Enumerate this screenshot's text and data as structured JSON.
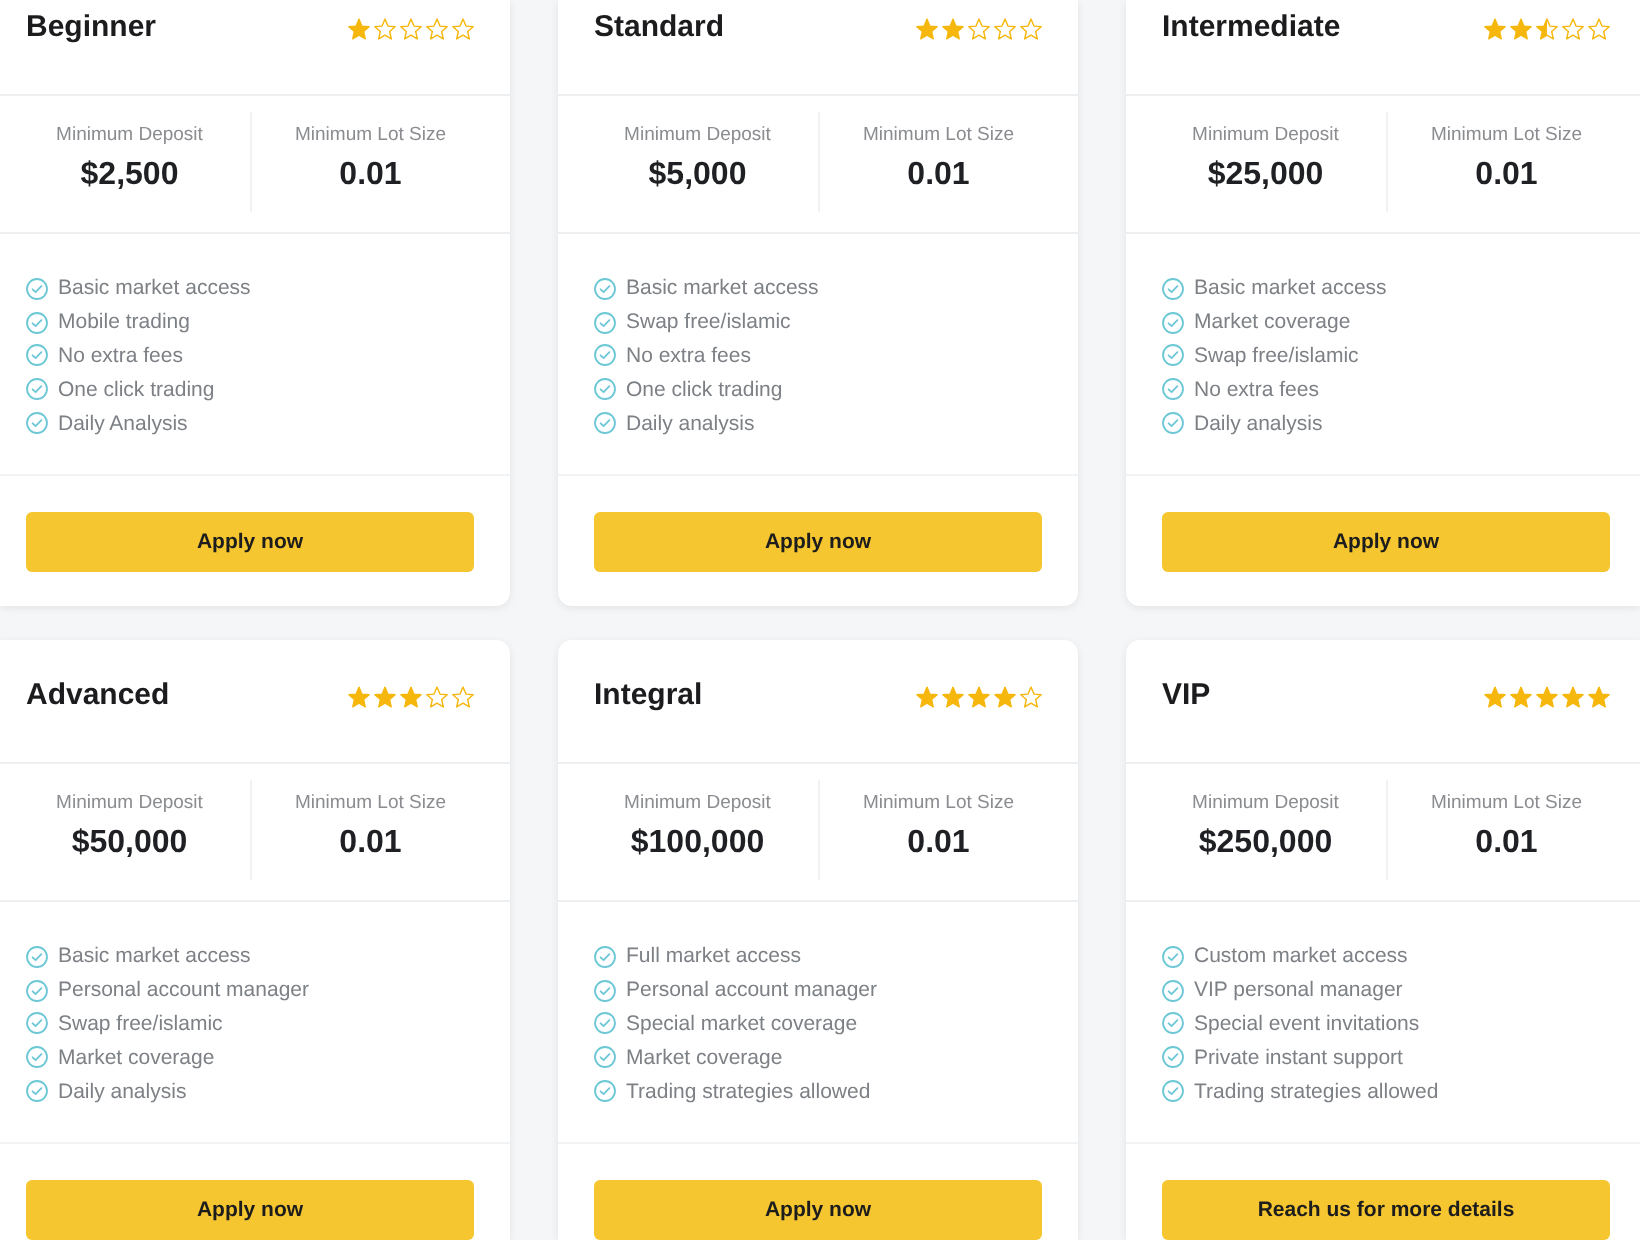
{
  "plans": [
    {
      "name": "Beginner",
      "stars": 1,
      "stats": [
        {
          "label": "Minimum Deposit",
          "value": "$2,500"
        },
        {
          "label": "Minimum Lot Size",
          "value": "0.01"
        }
      ],
      "features": [
        "Basic market access",
        "Mobile trading",
        "No extra fees",
        "One click trading",
        "Daily Analysis"
      ],
      "button": "Apply now"
    },
    {
      "name": "Standard",
      "stars": 2,
      "stats": [
        {
          "label": "Minimum Deposit",
          "value": "$5,000"
        },
        {
          "label": "Minimum Lot Size",
          "value": "0.01"
        }
      ],
      "features": [
        "Basic market access",
        "Swap free/islamic",
        "No extra fees",
        "One click trading",
        "Daily analysis"
      ],
      "button": "Apply now"
    },
    {
      "name": "Intermediate",
      "stars": 2.5,
      "stats": [
        {
          "label": "Minimum Deposit",
          "value": "$25,000"
        },
        {
          "label": "Minimum Lot Size",
          "value": "0.01"
        }
      ],
      "features": [
        "Basic market access",
        "Market coverage",
        "Swap free/islamic",
        "No extra fees",
        "Daily analysis"
      ],
      "button": "Apply now"
    },
    {
      "name": "Advanced",
      "stars": 3,
      "stats": [
        {
          "label": "Minimum Deposit",
          "value": "$50,000"
        },
        {
          "label": "Minimum Lot Size",
          "value": "0.01"
        }
      ],
      "features": [
        "Basic market access",
        "Personal account manager",
        "Swap free/islamic",
        "Market coverage",
        "Daily analysis"
      ],
      "button": "Apply now"
    },
    {
      "name": "Integral",
      "stars": 4,
      "stats": [
        {
          "label": "Minimum Deposit",
          "value": "$100,000"
        },
        {
          "label": "Minimum Lot Size",
          "value": "0.01"
        }
      ],
      "features": [
        "Full market access",
        "Personal account manager",
        "Special market coverage",
        "Market coverage",
        "Trading strategies allowed"
      ],
      "button": "Apply now"
    },
    {
      "name": "VIP",
      "stars": 5,
      "stats": [
        {
          "label": "Minimum Deposit",
          "value": "$250,000"
        },
        {
          "label": "Minimum Lot Size",
          "value": "0.01"
        }
      ],
      "features": [
        "Custom market access",
        "VIP personal manager",
        "Special event invitations",
        "Private instant support",
        "Trading strategies allowed"
      ],
      "button": "Reach us for more details"
    }
  ]
}
